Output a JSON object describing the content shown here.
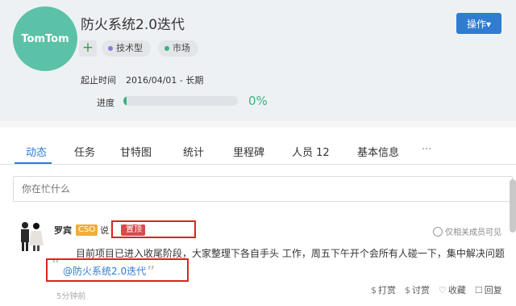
{
  "project": {
    "avatar_text": "TomTom",
    "title": "防火系统2.0迭代",
    "add_icon": "plus-icon",
    "tags": [
      "技术型",
      "市场"
    ],
    "tag_colors": [
      "#8c7bd8",
      "#3bb27f"
    ],
    "start_label": "起止时间",
    "start_value": "2016/04/01 - 长期",
    "progress_label": "进度",
    "progress_value": 0,
    "progress_text": "0%",
    "action_label": "操作▾"
  },
  "tabs": [
    "动态",
    "任务",
    "甘特图",
    "统计",
    "里程碑",
    "人员 12",
    "基本信息",
    "···"
  ],
  "active_tab": 0,
  "composer": {
    "placeholder": "你在忙什么"
  },
  "post": {
    "author": "罗宾",
    "role": "CSO",
    "says": "说",
    "pin_label": "置顶",
    "visibility": "仅相关成员可见",
    "content": "目前项目已进入收尾阶段，大家整理下各自手头 工作，周五下午开个会所有人碰一下，集中解决问题",
    "mention": "@防火系统2.0迭代",
    "time": "5分钟前",
    "actions": [
      {
        "icon": "reward-icon",
        "label": "打赏"
      },
      {
        "icon": "discuss-icon",
        "label": "讨赏"
      },
      {
        "icon": "heart-icon",
        "label": "收藏"
      },
      {
        "icon": "like-icon",
        "label": "回复"
      }
    ]
  },
  "colors": {
    "accent": "#2f7cd0",
    "green": "#3bb27f",
    "avatar": "#5bc2a8",
    "highlight": "#dd2222"
  }
}
